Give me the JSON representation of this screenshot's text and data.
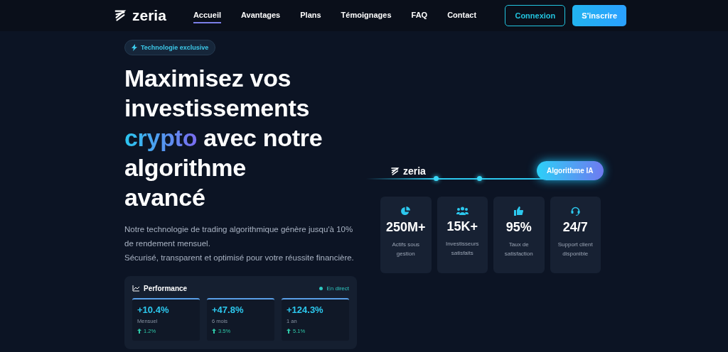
{
  "nav": {
    "brand": "zeria",
    "links": [
      {
        "label": "Accueil",
        "selected": true
      },
      {
        "label": "Avantages",
        "selected": false
      },
      {
        "label": "Plans",
        "selected": false
      },
      {
        "label": "Témoignages",
        "selected": false
      },
      {
        "label": "FAQ",
        "selected": false
      },
      {
        "label": "Contact",
        "selected": false
      }
    ],
    "buttons": [
      {
        "label": "Connexion",
        "kind": "outline"
      },
      {
        "label": "S'inscrire",
        "kind": "filled"
      }
    ]
  },
  "hero": {
    "badge": "Technologie exclusive",
    "headline": {
      "before": "Maximisez vos investissements",
      "highlight": "crypto",
      "after": "avec notre algorithme avancé"
    },
    "paragraphs": [
      "Notre technologie de trading algorithmique génère jusqu'à 10% de rendement mensuel.",
      "Sécurisé, transparent et optimisé pour votre réussite financière."
    ]
  },
  "performance": {
    "title": "Performance",
    "live": "En direct",
    "cards": [
      {
        "value": "+10.4%",
        "label": "Mensuel",
        "change": "1.2%"
      },
      {
        "value": "+47.8%",
        "label": "6 mois",
        "change": "3.5%"
      },
      {
        "value": "+124.3%",
        "label": "1 an",
        "change": "5.1%"
      }
    ]
  },
  "visual": {
    "brand": "zeria",
    "tag": "Algorithme IA"
  },
  "stats": [
    {
      "value": "250M+",
      "label": "Actifs sous gestion"
    },
    {
      "value": "15K+",
      "label": "Investisseurs satisfaits"
    },
    {
      "value": "95%",
      "label": "Taux de satisfaction"
    },
    {
      "value": "24/7",
      "label": "Support client disponible"
    }
  ]
}
